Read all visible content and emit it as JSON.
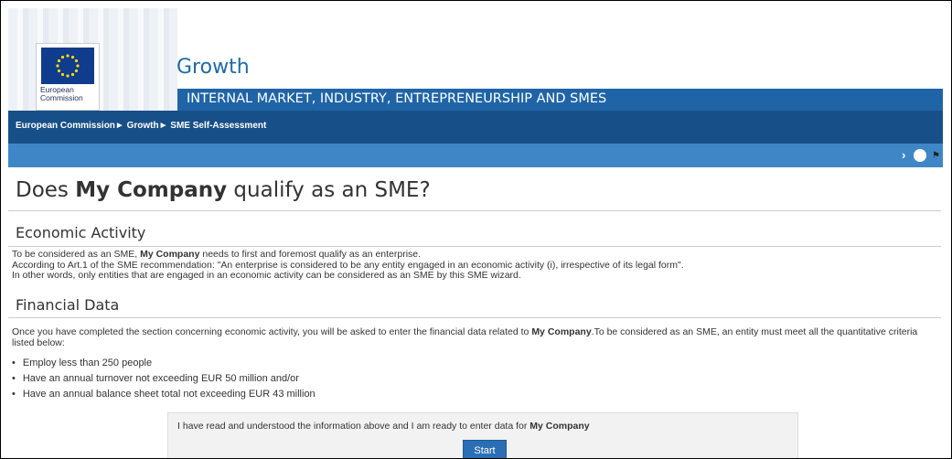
{
  "header": {
    "logo_line1": "European",
    "logo_line2": "Commission",
    "site_title": "Growth",
    "band_title": "INTERNAL MARKET, INDUSTRY, ENTREPRENEURSHIP AND SMES"
  },
  "breadcrumb": {
    "items": [
      "European Commission",
      "Growth",
      "SME Self-Assessment"
    ],
    "separator": "►"
  },
  "toolbar": {
    "arrow": "›",
    "flag": "⚑"
  },
  "page": {
    "title_pre": "Does ",
    "title_company": "My Company",
    "title_post": " qualify as an SME?"
  },
  "economic": {
    "heading": "Economic Activity",
    "line1_pre": "To be considered as an SME, ",
    "line1_company": "My Company",
    "line1_post": " needs to first and foremost qualify as an enterprise.",
    "line2": "According to Art.1 of the SME recommendation: \"An enterprise is considered to be any entity engaged in an economic activity (i), irrespective of its legal form\".",
    "line3": "In other words, only entities that are engaged in an economic activity can be considered as an SME by this SME wizard."
  },
  "financial": {
    "heading": "Financial Data",
    "para_pre": "Once you have completed the section concerning economic activity, you will be asked to enter the financial data related to ",
    "para_company": "My Company",
    "para_post": ".To be considered as an SME, an entity must meet all the quantitative criteria listed below:",
    "criteria": [
      "Employ less than 250 people",
      "Have an annual turnover not exceeding EUR 50 million and/or",
      "Have an annual balance sheet total not exceeding EUR 43 million"
    ]
  },
  "confirm": {
    "text_pre": "I have read and understood the information above and I am ready to enter data for ",
    "text_company": "My Company",
    "start_label": "Start"
  },
  "colors": {
    "band": "#1f64a7",
    "breadcrumb": "#174f88",
    "toolbar": "#3f86c7",
    "button": "#2a6fb5",
    "title": "#1d6aa8"
  }
}
